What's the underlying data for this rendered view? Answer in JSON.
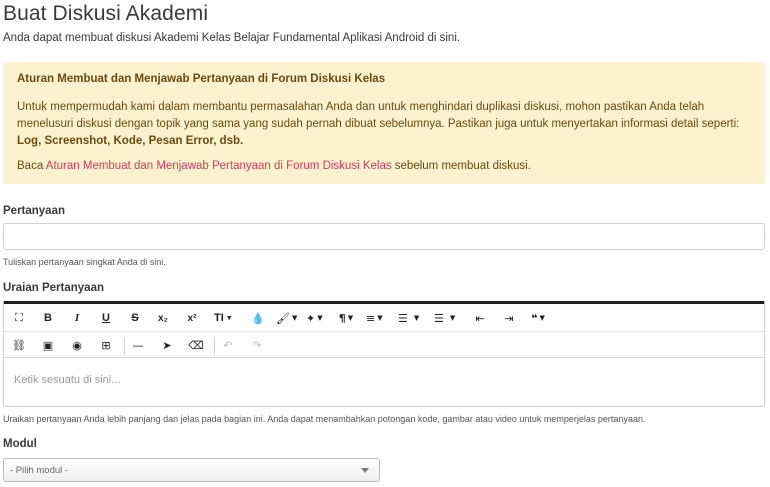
{
  "page": {
    "title": "Buat Diskusi Akademi",
    "subtitle": "Anda dapat membuat diskusi Akademi Kelas Belajar Fundamental Aplikasi Android di sini."
  },
  "notice": {
    "title": "Aturan Membuat dan Menjawab Pertanyaan di Forum Diskusi Kelas",
    "body": "Untuk mempermudah kami dalam membantu permasalahan Anda dan untuk menghindari duplikasi diskusi, mohon pastikan Anda telah menelusuri diskusi dengan topik yang sama yang sudah pernah dibuat sebelumnya. Pastikan juga untuk menyertakan informasi detail seperti: ",
    "body_bold": "Log, Screenshot, Kode, Pesan Error, dsb.",
    "read_prefix": "Baca ",
    "read_link": "Aturan Membuat dan Menjawab Pertanyaan di Forum Diskusi Kelas",
    "read_suffix": " sebelum membuat diskusi.",
    "colors": {
      "background": "#fdf2cf",
      "text": "#6b4a0f",
      "link": "#d63a5b"
    }
  },
  "question": {
    "label": "Pertanyaan",
    "value": "",
    "help": "Tuliskan pertanyaan singkat Anda di sini."
  },
  "description": {
    "label": "Uraian Pertanyaan",
    "placeholder": "Ketik sesuatu di sini...",
    "help": "Uraikan pertanyaan Anda lebih panjang dan jelas pada bagian ini. Anda dapat menambahkan potongan kode, gambar atau video untuk memperjelas pertanyaan.",
    "toolbar": {
      "row1": [
        {
          "icon": "fullscreen-icon",
          "glyph": "⛶"
        },
        {
          "icon": "bold-icon",
          "glyph": "B"
        },
        {
          "icon": "italic-icon",
          "glyph": "I"
        },
        {
          "icon": "underline-icon",
          "glyph": "U"
        },
        {
          "icon": "strikethrough-icon",
          "glyph": "S"
        },
        {
          "icon": "subscript-icon",
          "glyph": "x₂"
        },
        {
          "icon": "superscript-icon",
          "glyph": "x²"
        },
        {
          "icon": "font-size-icon",
          "glyph": "T↕"
        },
        {
          "icon": "color-icon",
          "glyph": "●"
        },
        {
          "icon": "brush-icon",
          "glyph": "✎"
        },
        {
          "icon": "magic-icon",
          "glyph": "✦"
        },
        {
          "icon": "paragraph-icon",
          "glyph": "¶"
        },
        {
          "icon": "align-left-icon",
          "glyph": "≡"
        },
        {
          "icon": "ordered-list-icon",
          "glyph": "⋮≡"
        },
        {
          "icon": "unordered-list-icon",
          "glyph": "•≡"
        },
        {
          "icon": "outdent-icon",
          "glyph": "⇤"
        },
        {
          "icon": "indent-icon",
          "glyph": "⇥"
        },
        {
          "icon": "quote-icon",
          "glyph": "❝"
        }
      ],
      "row2": [
        {
          "icon": "link-icon",
          "glyph": "🔗"
        },
        {
          "icon": "image-icon",
          "glyph": "▣"
        },
        {
          "icon": "camera-icon",
          "glyph": "◉"
        },
        {
          "icon": "table-icon",
          "glyph": "⊞"
        },
        {
          "icon": "horizontal-line-icon",
          "glyph": "—"
        },
        {
          "icon": "pointer-icon",
          "glyph": "➤"
        },
        {
          "icon": "eraser-icon",
          "glyph": "⌫"
        },
        {
          "icon": "undo-icon",
          "glyph": "↶"
        },
        {
          "icon": "redo-icon",
          "glyph": "↷"
        }
      ]
    }
  },
  "module": {
    "label": "Modul",
    "selected": "- Pilih modul -"
  }
}
